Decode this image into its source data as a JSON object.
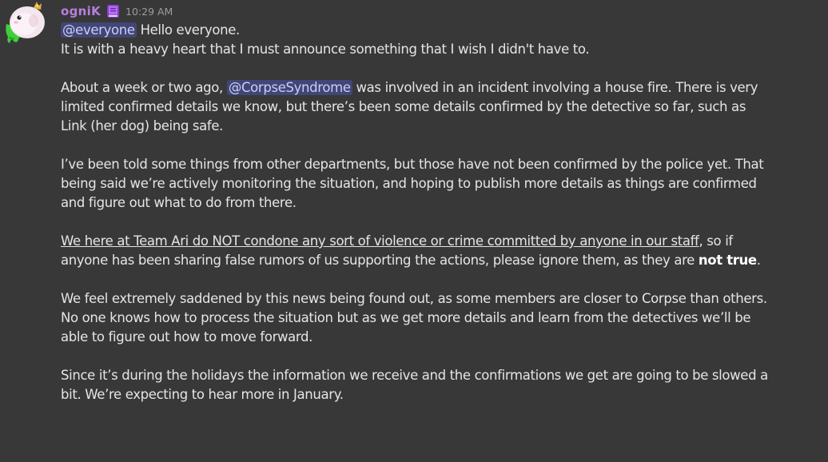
{
  "message": {
    "author": {
      "username": "ogniK",
      "name_color": "#b77fe0",
      "avatar_icon": "egg-avatar-with-green-slime",
      "role_icon": "purple-book-icon"
    },
    "timestamp": "10:29 AM",
    "mentions": {
      "everyone": "@everyone",
      "corpse": "@CorpseSyndrome"
    },
    "p1": {
      "after_everyone": " Hello everyone.",
      "line2": "It is with a heavy heart that I must announce something that I wish I didn't have to."
    },
    "p2": {
      "before_mention": "About a week or two ago, ",
      "after_mention": " was involved in an incident involving a house fire. There is very",
      "line2": "limited confirmed details we know, but there’s been some details confirmed by the detective so far, such as",
      "line3": "Link (her dog) being safe."
    },
    "p3": {
      "line1": "I’ve been told some things from other departments, but those have not been confirmed by the police yet. That",
      "line2": "being said we’re actively monitoring the situation, and hoping to publish more details as things are confirmed",
      "line3": "and figure out what to do from there."
    },
    "p4": {
      "underlined": "We here at Team Ari do NOT condone any sort of violence or crime committed by anyone in our staff",
      "after_underline": ", so if",
      "line2_before_bold": "anyone has been sharing false rumors of us supporting the actions, please ignore them, as they are ",
      "bold": "not true",
      "line2_end": "."
    },
    "p5": {
      "line1": "We feel extremely saddened by this news being found out, as some members are closer to Corpse than others.",
      "line2": "No one knows how to process the situation but as we get more details and learn from the detectives we’ll be",
      "line3": "able to figure out how to move forward."
    },
    "p6": {
      "line1": "Since it’s during the holidays the information we receive and the confirmations we get are going to be slowed a",
      "line2": "bit. We’re expecting to hear more in January."
    }
  }
}
